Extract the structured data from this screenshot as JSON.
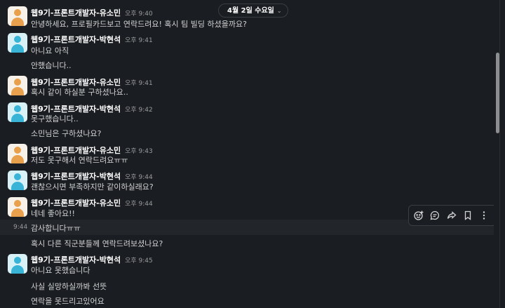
{
  "date_divider": {
    "label": "4월 2일 수요일"
  },
  "messages": [
    {
      "author": "웹9기-프론트개발자-유소민",
      "time": "오후 9:40",
      "avatar": "orange",
      "text": "안녕하세요, 프로필카드보고 연락드려요! 혹시 팀 빌딩 하셨을까요?"
    },
    {
      "author": "웹9기-프론트개발자-박현석",
      "time": "오후 9:41",
      "avatar": "teal",
      "text": "아니요 아직"
    },
    {
      "text": "안했습니다.."
    },
    {
      "author": "웹9기-프론트개발자-유소민",
      "time": "오후 9:41",
      "avatar": "orange",
      "text": "혹시 같이 하실분 구하셨나요.."
    },
    {
      "author": "웹9기-프론트개발자-박현석",
      "time": "오후 9:42",
      "avatar": "teal",
      "text": "못구했습니다.."
    },
    {
      "text": "소민님은 구하셨나요?"
    },
    {
      "author": "웹9기-프론트개발자-유소민",
      "time": "오후 9:43",
      "avatar": "orange",
      "text": "저도 못구해서 연락드려요ㅠㅠ"
    },
    {
      "author": "웹9기-프론트개발자-박현석",
      "time": "오후 9:44",
      "avatar": "teal",
      "text": "괜찮으시면 부족하지만 같이하실래요?"
    },
    {
      "author": "웹9기-프론트개발자-유소민",
      "time": "오후 9:44",
      "avatar": "orange",
      "text": "네네 좋아요!!"
    },
    {
      "hover_time": "9:44",
      "text": "감사합니다ㅠㅠ"
    },
    {
      "text": "혹시 다른 직군분들께 연락드려보셨나요?"
    },
    {
      "author": "웹9기-프론트개발자-박현석",
      "time": "오후 9:45",
      "avatar": "teal",
      "text": "아니요 못했습니다"
    },
    {
      "text": "사실 실망하실까봐 선뜻"
    },
    {
      "text": "연락을 못드리고있어요"
    }
  ],
  "message_actions": {
    "icons": [
      "add-reaction-icon",
      "reply-in-thread-icon",
      "forward-icon",
      "bookmark-icon",
      "more-actions-icon"
    ]
  },
  "colors": {
    "background": "#1a1d21",
    "text": "#d1d2d3",
    "author": "#ffffff",
    "muted": "#9a9b9d",
    "avatar_orange": "#e9a04c",
    "avatar_teal": "#39b4d6"
  }
}
